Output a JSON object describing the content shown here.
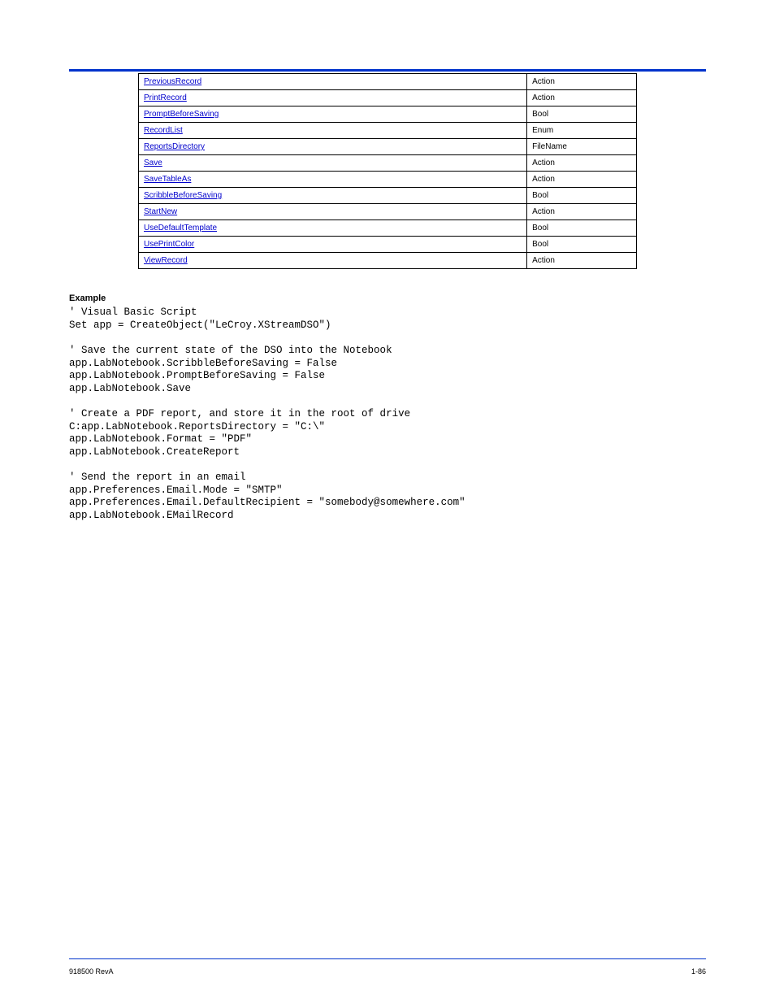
{
  "table": {
    "rows": [
      {
        "c1": "PreviousRecord",
        "c2": "Action"
      },
      {
        "c1": "PrintRecord",
        "c2": "Action"
      },
      {
        "c1": "PromptBeforeSaving",
        "c2": "Bool"
      },
      {
        "c1": "RecordList",
        "c2": "Enum"
      },
      {
        "c1": "ReportsDirectory",
        "c2": "FileName"
      },
      {
        "c1": "Save",
        "c2": "Action"
      },
      {
        "c1": "SaveTableAs",
        "c2": "Action"
      },
      {
        "c1": "ScribbleBeforeSaving",
        "c2": "Bool"
      },
      {
        "c1": "StartNew",
        "c2": "Action"
      },
      {
        "c1": "UseDefaultTemplate",
        "c2": "Bool"
      },
      {
        "c1": "UsePrintColor",
        "c2": "Bool"
      },
      {
        "c1": "ViewRecord",
        "c2": "Action"
      }
    ]
  },
  "exampleLabel": "Example",
  "code": "' Visual Basic Script\nSet app = CreateObject(\"LeCroy.XStreamDSO\")\n\n' Save the current state of the DSO into the Notebook\napp.LabNotebook.ScribbleBeforeSaving = False\napp.LabNotebook.PromptBeforeSaving = False\napp.LabNotebook.Save\n\n' Create a PDF report, and store it in the root of drive\nC:app.LabNotebook.ReportsDirectory = \"C:\\\"\napp.LabNotebook.Format = \"PDF\"\napp.LabNotebook.CreateReport\n\n' Send the report in an email\napp.Preferences.Email.Mode = \"SMTP\"\napp.Preferences.Email.DefaultRecipient = \"somebody@somewhere.com\"\napp.LabNotebook.EMailRecord",
  "footer": {
    "left": "918500 RevA",
    "right": "1-86"
  }
}
